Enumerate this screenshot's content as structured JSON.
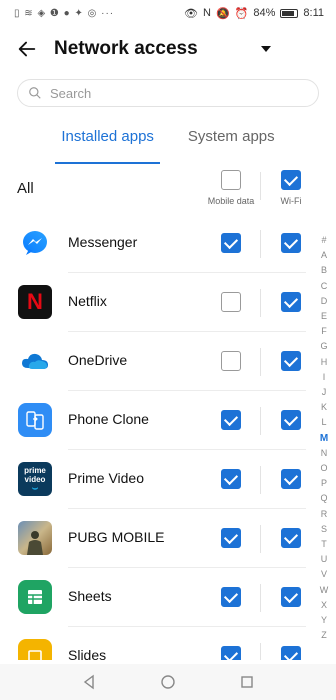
{
  "status": {
    "time": "8:11",
    "battery": "84%",
    "left_icons": "▯ ≋ ◈ ❶ ● ✦ ◎ ···"
  },
  "header": {
    "title": "Network access"
  },
  "search": {
    "placeholder": "Search"
  },
  "tabs": [
    {
      "label": "Installed apps",
      "active": true
    },
    {
      "label": "System apps",
      "active": false
    }
  ],
  "all_row": {
    "label": "All",
    "mobile_label": "Mobile data",
    "wifi_label": "Wi-Fi",
    "mobile_checked": false,
    "wifi_checked": true
  },
  "apps": [
    {
      "name": "Messenger",
      "icon": "messenger-icon",
      "mobile": true,
      "wifi": true
    },
    {
      "name": "Netflix",
      "icon": "netflix-icon",
      "mobile": false,
      "wifi": true
    },
    {
      "name": "OneDrive",
      "icon": "onedrive-icon",
      "mobile": false,
      "wifi": true
    },
    {
      "name": "Phone Clone",
      "icon": "phone-clone-icon",
      "mobile": true,
      "wifi": true
    },
    {
      "name": "Prime Video",
      "icon": "prime-video-icon",
      "mobile": true,
      "wifi": true
    },
    {
      "name": "PUBG MOBILE",
      "icon": "pubg-icon",
      "mobile": true,
      "wifi": true
    },
    {
      "name": "Sheets",
      "icon": "sheets-icon",
      "mobile": true,
      "wifi": true
    },
    {
      "name": "Slides",
      "icon": "slides-icon",
      "mobile": true,
      "wifi": true
    }
  ],
  "index": {
    "letters": [
      "#",
      "A",
      "B",
      "C",
      "D",
      "E",
      "F",
      "G",
      "H",
      "I",
      "J",
      "K",
      "L",
      "M",
      "N",
      "O",
      "P",
      "Q",
      "R",
      "S",
      "T",
      "U",
      "V",
      "W",
      "X",
      "Y",
      "Z"
    ],
    "active": "M"
  },
  "icon_text": {
    "netflix": "N",
    "prime": "prime video"
  },
  "colors": {
    "accent": "#1d72d6"
  }
}
